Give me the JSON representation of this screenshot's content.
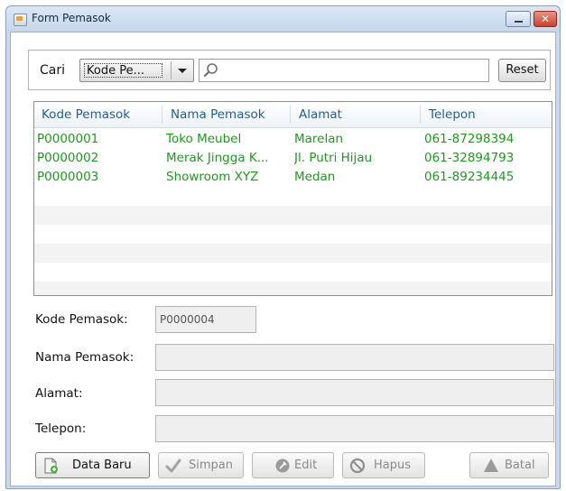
{
  "window": {
    "title": "Form Pemasok"
  },
  "search": {
    "label": "Cari",
    "field_selected": "Kode Pe...",
    "query": "",
    "reset_label": "Reset"
  },
  "table": {
    "columns": [
      "Kode Pemasok",
      "Nama Pemasok",
      "Alamat",
      "Telepon"
    ],
    "rows": [
      [
        "P0000001",
        "Toko Meubel",
        "Marelan",
        "061-87298394"
      ],
      [
        "P0000002",
        "Merak Jingga K...",
        "Jl. Putri Hijau",
        "061-32894793"
      ],
      [
        "P0000003",
        "Showroom XYZ",
        "Medan",
        "061-89234445"
      ]
    ]
  },
  "form": {
    "kode_label": "Kode Pemasok:",
    "kode_value": "P0000004",
    "nama_label": "Nama Pemasok:",
    "nama_value": "",
    "alamat_label": "Alamat:",
    "alamat_value": "",
    "telepon_label": "Telepon:",
    "telepon_value": ""
  },
  "buttons": {
    "data_baru": "Data Baru",
    "simpan": "Simpan",
    "edit": "Edit",
    "hapus": "Hapus",
    "batal": "Batal"
  },
  "colors": {
    "row_text": "#1c9a1c",
    "header_text": "#1e5f99",
    "close_button": "#c7432e"
  }
}
